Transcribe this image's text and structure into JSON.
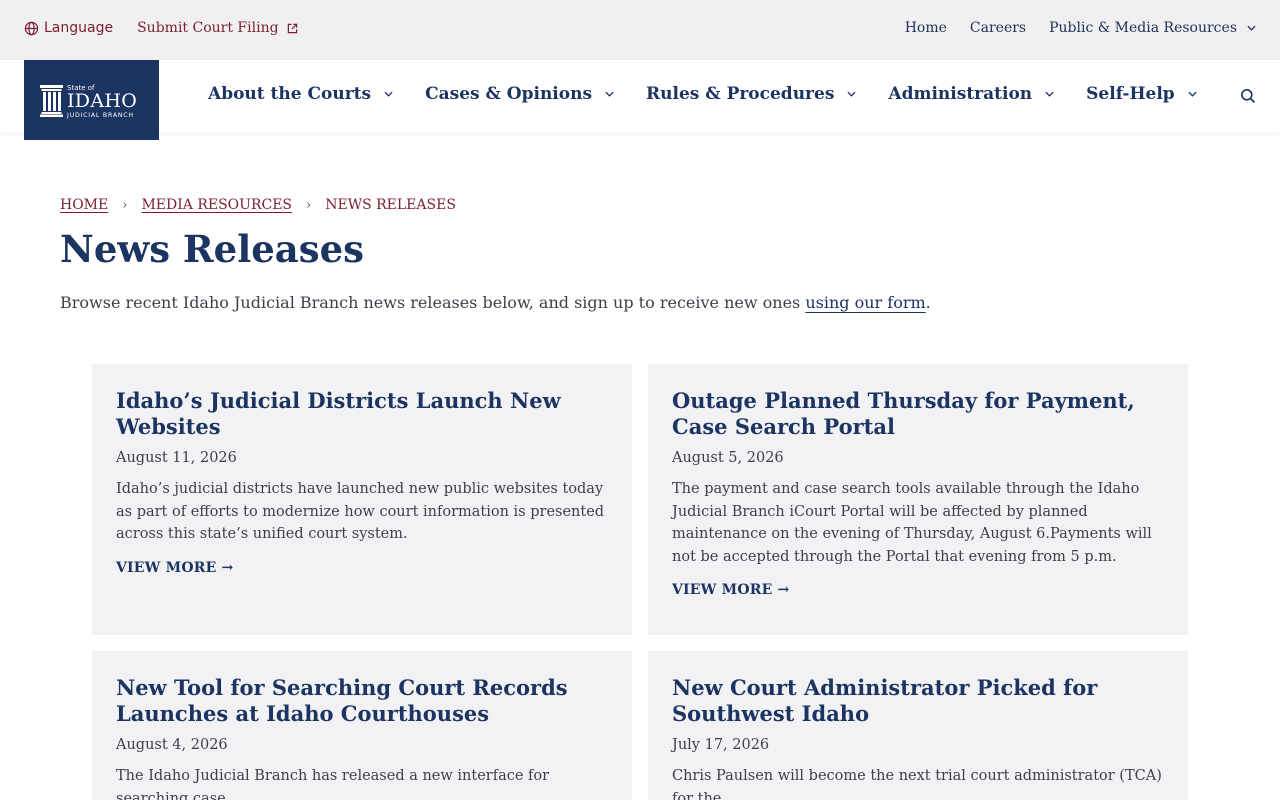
{
  "utility": {
    "language_label": "Language",
    "submit_label": "Submit Court Filing",
    "links": [
      "Home",
      "Careers",
      "Public & Media Resources"
    ]
  },
  "logo": {
    "state_of": "State of",
    "name": "IDAHO",
    "branch": "JUDICIAL BRANCH"
  },
  "nav": [
    "About the Courts",
    "Cases & Opinions",
    "Rules & Procedures",
    "Administration",
    "Self-Help"
  ],
  "breadcrumb": {
    "home": "HOME",
    "media": "MEDIA RESOURCES",
    "current": "NEWS RELEASES"
  },
  "page": {
    "title": "News Releases",
    "intro_before": "Browse recent Idaho Judicial Branch news releases below, and sign up to receive new ones ",
    "intro_link": "using our form",
    "intro_after": "."
  },
  "cards": [
    {
      "title": "Idaho’s Judicial Districts Launch New Websites",
      "date": "August 11, 2026",
      "excerpt": "Idaho’s judicial districts have launched new public websites today as part of efforts to modernize how court information is presented across this state’s unified court system.",
      "more": "VIEW MORE →"
    },
    {
      "title": "Outage Planned Thursday for Payment, Case Search Portal",
      "date": "August 5, 2026",
      "excerpt": "The payment and case search tools available through the Idaho Judicial Branch iCourt Portal will be affected by planned maintenance on the evening of Thursday, August 6.Payments will not be accepted through the Portal that evening from 5 p.m.",
      "more": "VIEW MORE →"
    },
    {
      "title": "New Tool for Searching Court Records Launches at Idaho Courthouses",
      "date": "August 4, 2026",
      "excerpt": "The Idaho Judicial Branch has released a new interface for searching case",
      "more": ""
    },
    {
      "title": "New Court Administrator Picked for Southwest Idaho",
      "date": "July 17, 2026",
      "excerpt": "Chris Paulsen will become the next trial court administrator (TCA) for the",
      "more": ""
    }
  ],
  "colors": {
    "navy": "#1c3461",
    "maroon": "#7a1f2b",
    "card_bg": "#f2f2f4",
    "utility_bg": "#f0f0f2"
  }
}
